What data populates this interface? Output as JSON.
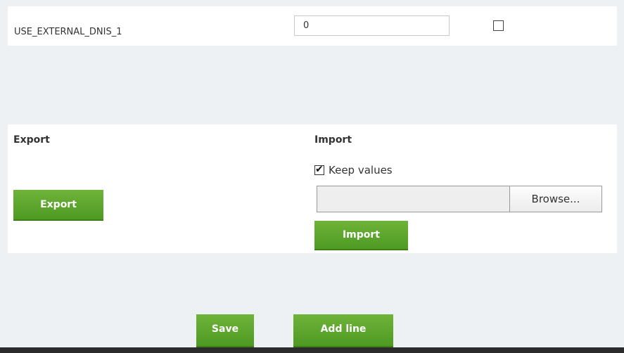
{
  "param_row": {
    "name": "USE_EXTERNAL_DNIS_1",
    "value": "0",
    "checked": false
  },
  "export": {
    "title": "Export",
    "button_label": "Export"
  },
  "import": {
    "title": "Import",
    "keep_values_label": "Keep values",
    "keep_values_checked": true,
    "browse_label": "Browse...",
    "button_label": "Import"
  },
  "actions": {
    "save_label": "Save",
    "add_line_label": "Add line"
  },
  "colors": {
    "button_green": "#5ca52c",
    "page_background": "#eef1f4",
    "panel_background": "#ffffff"
  }
}
